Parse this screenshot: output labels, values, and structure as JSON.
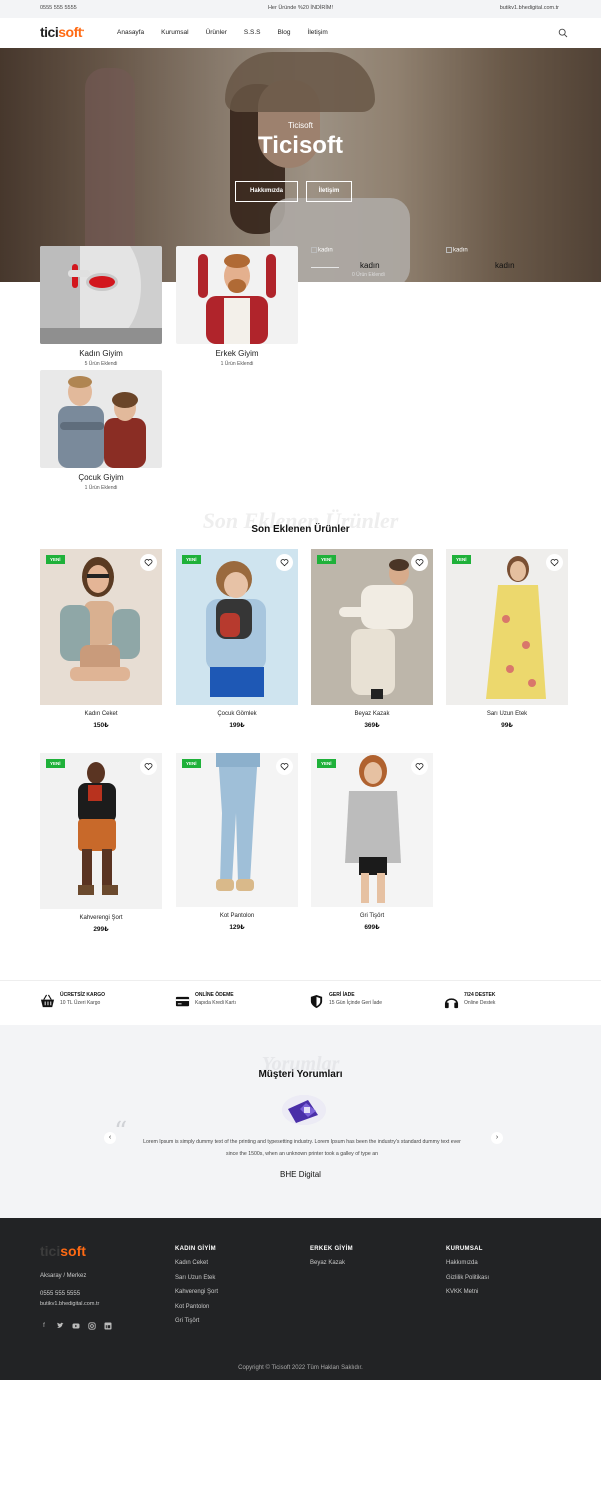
{
  "topbar": {
    "phone": "0555 555 5555",
    "promo": "Her Üründe %20 İNDİRİM!",
    "email": "butikv1.bhedigital.com.tr"
  },
  "nav": {
    "logo_main": "tici",
    "logo_accent": "soft",
    "items": [
      "Anasayfa",
      "Kurumsal",
      "Ürünler",
      "S.S.S",
      "Blog",
      "İletişim"
    ]
  },
  "hero": {
    "subtitle": "Ticisoft",
    "title": "Ticisoft",
    "button1": "Hakkımızda",
    "button2": "İletişim"
  },
  "broken_images": [
    {
      "alt": "kadın",
      "label": "kadın",
      "sub": "0 Ürün Eklendi"
    },
    {
      "alt": "kadın",
      "label": "kadın"
    }
  ],
  "categories": [
    {
      "name": "Kadın Giyim",
      "count": "5 Ürün Eklendi"
    },
    {
      "name": "Erkek Giyim",
      "count": "1 Ürün Eklendi"
    },
    {
      "name": "Çocuk Giyim",
      "count": "1 Ürün Eklendi"
    }
  ],
  "latest": {
    "ghost": "Son Eklenen Ürünler",
    "title": "Son Eklenen Ürünler"
  },
  "products": [
    {
      "badge": "YENİ",
      "name": "Kadın Ceket",
      "price": "150₺"
    },
    {
      "badge": "YENİ",
      "name": "Çocuk Gömlek",
      "price": "199₺"
    },
    {
      "badge": "YENİ",
      "name": "Beyaz Kazak",
      "price": "369₺"
    },
    {
      "badge": "YENİ",
      "name": "Sarı Uzun Etek",
      "price": "99₺"
    },
    {
      "badge": "YENİ",
      "name": "Kahverengi Şort",
      "price": "299₺"
    },
    {
      "badge": "YENİ",
      "name": "Kot Pantolon",
      "price": "129₺"
    },
    {
      "badge": "YENİ",
      "name": "Gri Tişört",
      "price": "699₺"
    }
  ],
  "features": [
    {
      "icon": "basket-icon",
      "title": "ÜCRETSİZ KARGO",
      "sub": "10 TL Üzeri Kargo"
    },
    {
      "icon": "credit-card-icon",
      "title": "ONLİNE ÖDEME",
      "sub": "Kapıda Kredi Kartı"
    },
    {
      "icon": "shield-icon",
      "title": "GERİ İADE",
      "sub": "15 Gün İçinde Geri İade"
    },
    {
      "icon": "headphones-icon",
      "title": "7/24 DESTEK",
      "sub": "Online Destek"
    }
  ],
  "reviews": {
    "ghost": "Yorumlar",
    "title": "Müşteri Yorumları",
    "text_line1": "Lorem Ipsum is simply dummy text of the printing and typesetting industry. Lorem Ipsum has been the industry's standard dummy text ever",
    "text_line2": "since the 1500s, when an unknown printer took a galley of type an",
    "author": "BHE Digital"
  },
  "footer": {
    "logo_dim": "tici",
    "logo_accent": "soft",
    "address": "Aksaray / Merkez",
    "phone": "0555 555 5555",
    "email": "butikv1.bhedigital.com.tr",
    "columns": [
      {
        "heading": "KADIN GİYİM",
        "links": [
          "Kadın Ceket",
          "Sarı Uzun Etek",
          "Kahverengi Şort",
          "Kot Pantolon",
          "Gri Tişört"
        ]
      },
      {
        "heading": "ERKEK GİYİM",
        "links": [
          "Beyaz Kazak"
        ]
      },
      {
        "heading": "KURUMSAL",
        "links": [
          "Hakkımızda",
          "Gizlilik Politikası",
          "KVKK Metni"
        ]
      }
    ],
    "social": [
      "facebook-icon",
      "twitter-icon",
      "youtube-icon",
      "instagram-icon",
      "linkedin-icon"
    ],
    "copyright": "Copyright © Ticisoft 2022 Tüm Hakları Saklıdır."
  },
  "colors": {
    "accent": "#ff6a13",
    "badge": "#1fb13a",
    "footer_bg": "#222325",
    "light_bg": "#f3f4f6"
  }
}
